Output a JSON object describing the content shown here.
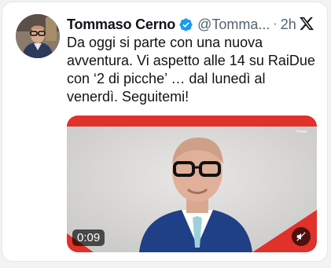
{
  "tweet": {
    "author_name": "Tommaso Cerno",
    "handle": "@Tomma...",
    "separator": "·",
    "time": "2h",
    "text": "Da oggi si parte con una nuova avventura. Vi aspetto alle 14 su RaiDue con ‘2 di picche’ … dal lunedì al venerdì. Seguitemi!"
  },
  "media": {
    "promo_label": "Promo",
    "duration": "0:09"
  },
  "colors": {
    "verified_badge": "#1d9bf0",
    "video_frame_red": "#e0312a",
    "text_primary": "#0f1419",
    "text_secondary": "#536471"
  },
  "icons": [
    "verified-badge-icon",
    "x-logo-icon",
    "mute-icon"
  ]
}
